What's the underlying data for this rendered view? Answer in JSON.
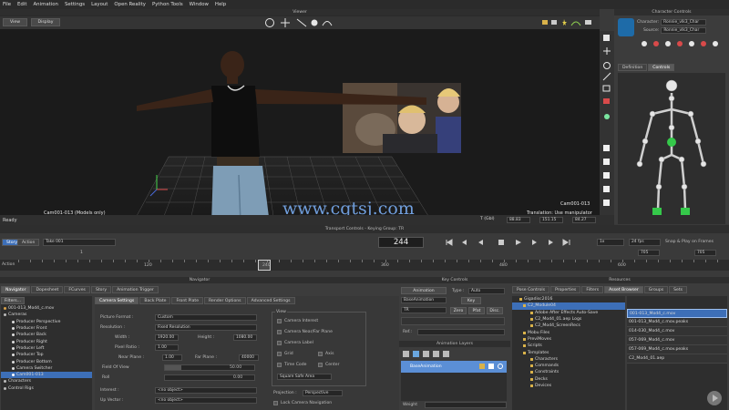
{
  "menu": [
    "File",
    "Edit",
    "Animation",
    "Settings",
    "Layout",
    "Open Reality",
    "Python Tools",
    "Window",
    "Help"
  ],
  "viewer": {
    "title": "Viewer",
    "view_btn": "View",
    "display_btn": "Display",
    "camera_label": "Cam001-013 (Models only)",
    "camera_label_right": "Cam001-013",
    "translation_status": "Translation: Use manipulator",
    "watermark": "www.cgtsj.com"
  },
  "status": {
    "ready": "Ready",
    "coord_label": "T (Gbl)",
    "x": "88.83",
    "y": "151.15",
    "z": "84.27"
  },
  "character_controls": {
    "title": "Character Controls",
    "character_label": "Character:",
    "character_value": "Ronnie_vlk3_Char",
    "source_label": "Source:",
    "source_value": "Ronnie_vlk3_Char",
    "tabs": [
      "Definition",
      "Controls"
    ]
  },
  "transport": {
    "title": "Transport Controls - Keying Group: TR",
    "story_tab": "Story",
    "action_tab": "Action",
    "take": "Take 001",
    "frame": "244",
    "fps": "24 fps",
    "snap": "Snap & Play on Frames",
    "speed": "1x",
    "start": "1",
    "end_a": "705",
    "end_b": "705",
    "action_label": "Action",
    "ticks": [
      "120",
      "240",
      "360",
      "480",
      "600"
    ]
  },
  "navigator": {
    "title": "Navigator",
    "tabs": [
      "Navigator",
      "Dopesheet",
      "FCurves",
      "Story",
      "Animation Trigger"
    ],
    "filters": "Filters...",
    "tree": [
      "001-013_Mod4_c.mov",
      "Cameras",
      "Producer Perspective",
      "Producer Front",
      "Producer Back",
      "Producer Right",
      "Producer Left",
      "Producer Top",
      "Producer Bottom",
      "Camera Switcher",
      "Cam001-013",
      "Characters",
      "Control Rigs"
    ],
    "subtabs": [
      "Camera Settings",
      "Back Plate",
      "Front Plate",
      "Render Options",
      "Advanced Settings"
    ],
    "picture_format_label": "Picture Format :",
    "picture_format_value": "Custom",
    "resolution_label": "Resolution :",
    "resolution_value": "Fixed Resolution",
    "width_label": "Width :",
    "width_value": "1920.00",
    "height_label": "Height :",
    "height_value": "1080.00",
    "pixel_ratio_label": "Pixel Ratio :",
    "pixel_ratio_value": "1.00",
    "near_plane_label": "Near Plane :",
    "near_plane_value": "1.00",
    "far_plane_label": "Far Plane :",
    "far_plane_value": "40000",
    "fov_label": "Field Of View",
    "fov_value": "50.00",
    "roll_label": "Roll",
    "roll_value": "0.00",
    "interest_label": "Interest :",
    "interest_value": "<no object>",
    "upvector_label": "Up Vector :",
    "upvector_value": "<no object>",
    "view_group": "View",
    "view_checks": [
      "Camera Interest",
      "Camera Near/Far Plane",
      "Camera Label",
      "Grid",
      "Time Code",
      "Square Safe Area"
    ],
    "axis_label": "Axis",
    "center_label": "Center",
    "projection_label": "Projection :",
    "projection_value": "Perspective",
    "lock_nav": "Lock Camera Navigation"
  },
  "key_controls": {
    "title": "Key Controls",
    "animation_btn": "Animation",
    "type_label": "Type :",
    "type_value": "Auto",
    "base_animation": "BaseAnimation",
    "key_btn": "Key",
    "tr_value": "TR",
    "zero_btn": "Zero",
    "pfat_btn": "Pfat",
    "disc_btn": "Disc.",
    "ref_label": "Ref.:",
    "layers_title": "Animation Layers",
    "layer_name": "BaseAnimation",
    "weight_label": "Weight"
  },
  "resources": {
    "title": "Resources",
    "tabs": [
      "Pose Controls",
      "Properties",
      "Filters",
      "Asset Browser",
      "Groups",
      "Sets"
    ],
    "folders": [
      "Gigadisc2016",
      "C2_Module04",
      "Adobe After Effects Auto-Save",
      "C2_Mod4_01.aep Logs",
      "C2_Mod4_ScreenRecs",
      "Mobu Files",
      "PreviMoves",
      "Scripts",
      "Templates",
      "Characters",
      "Commands",
      "Constraints",
      "Decks",
      "Devices"
    ],
    "files": [
      "001-013_Mod4_c.mov",
      "001-013_Mod4_c.mov.peaks",
      "014-030_Mod4_c.mov",
      "057-069_Mod4_c.mov",
      "057-069_Mod4_c.mov.peaks",
      "C2_Mod4_01.aep"
    ]
  },
  "colors": {
    "accent": "#5b8fd6",
    "selection": "#3d6fb8",
    "green": "#35c94a",
    "timecode_bg": "#1e1e1e"
  }
}
